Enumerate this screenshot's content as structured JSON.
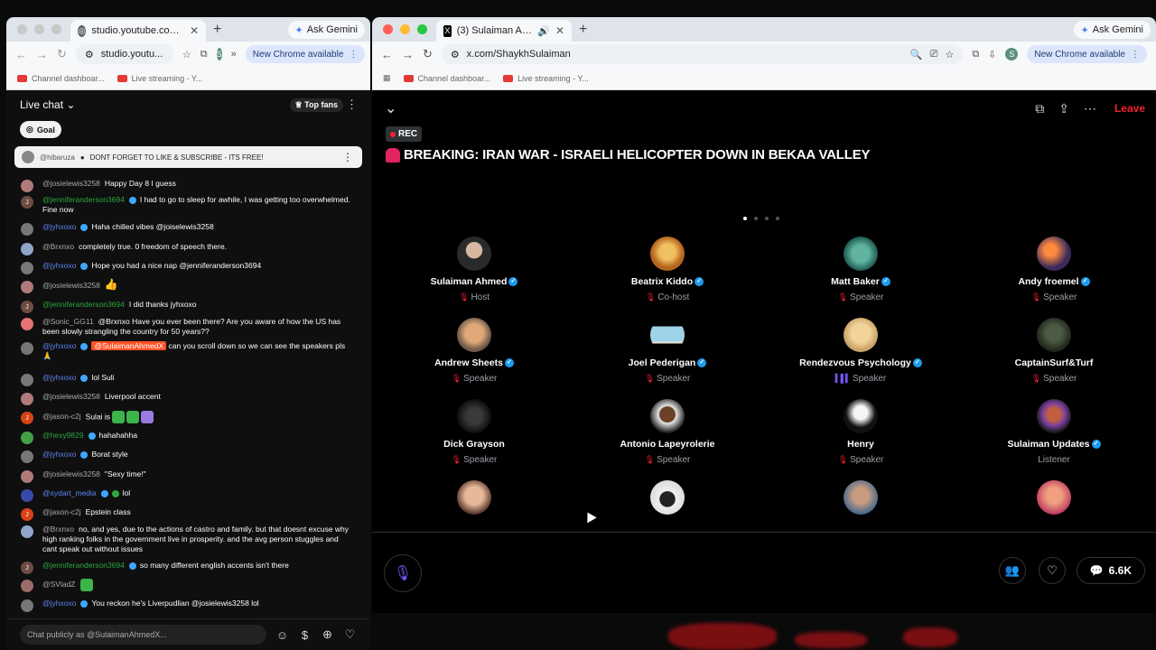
{
  "left_browser": {
    "tab_title": "studio.youtube.com/live_chat",
    "ask_gemini": "Ask Gemini",
    "address": "studio.youtu...",
    "new_chrome": "New Chrome available",
    "profile_initial": "S",
    "bookmarks": [
      "Channel dashboar...",
      "Live streaming - Y..."
    ]
  },
  "right_browser": {
    "tab_title": "(3) Sulaiman Ahmed (@S",
    "ask_gemini": "Ask Gemini",
    "address": "x.com/ShaykhSulaiman",
    "new_chrome": "New Chrome available",
    "profile_initial": "S",
    "bookmarks": [
      "Channel dashboar...",
      "Live streaming - Y..."
    ]
  },
  "chat": {
    "title": "Live chat",
    "top_fans": "Top fans",
    "goal": "Goal",
    "pinned": {
      "author": "@hibaruza",
      "text": "DONT FORGET TO LIKE & SUBSCRIBE - ITS FREE!"
    },
    "input_placeholder": "Chat publicly as @SulaimanAhmedX...",
    "messages": [
      {
        "author": "@josielewis3258",
        "text": "Happy Day 8 I guess"
      },
      {
        "author": "@jenniferanderson3694",
        "text": "I had to go to sleep for awhile, I was getting too overwhelmed. Fine now"
      },
      {
        "author": "@jyhxoxo",
        "text": "Haha chilled vibes @joiselewis3258"
      },
      {
        "author": "@Brxnxo",
        "text": "completely true. 0 freedom of speech there."
      },
      {
        "author": "@jyhxoxo",
        "text": "Hope you had a nice nap @jenniferanderson3694"
      },
      {
        "author": "@josielewis3258",
        "text": "👍"
      },
      {
        "author": "@jenniferanderson3694",
        "text": "I did thanks jyhxoxo"
      },
      {
        "author": "@Sonic_GG11",
        "text": "@Brxnxo Have you ever been there? Are you aware of how the US has been slowly strangling the country for 50 years??"
      },
      {
        "author": "@jyhxoxo",
        "mention": "@SulaimanAhmedX",
        "text": "can you scroll down so we can see the speakers pls 🙏"
      },
      {
        "author": "@jyhxoxo",
        "text": "lol Suli"
      },
      {
        "author": "@josielewis3258",
        "text": "Liverpool accent"
      },
      {
        "author": "@jason-c2j",
        "text": "Sulai is"
      },
      {
        "author": "@hexy9829",
        "text": "hahahahha"
      },
      {
        "author": "@jyhxoxo",
        "text": "Borat style"
      },
      {
        "author": "@josielewis3258",
        "text": "\"Sexy time!\""
      },
      {
        "author": "@sydart_media",
        "text": "lol"
      },
      {
        "author": "@jason-c2j",
        "text": "Epstein class"
      },
      {
        "author": "@Brxnxo",
        "text": "no, and yes, due to the actions of castro and family. but that doesnt excuse why high ranking folks in the government live in prosperity. and the avg person stuggles and cant speak out without issues"
      },
      {
        "author": "@jenniferanderson3694",
        "text": "so many different english accents isn't there"
      },
      {
        "author": "@SVladZ",
        "text": ""
      },
      {
        "author": "@jyhxoxo",
        "text": "You reckon he's Liverpudlian @josielewis3258 lol"
      }
    ]
  },
  "space": {
    "leave": "Leave",
    "rec": "REC",
    "title": "BREAKING: IRAN WAR - ISRAELI HELICOPTER DOWN IN BEKAA VALLEY",
    "count": "6.6K",
    "participants": [
      {
        "name": "Sulaiman Ahmed",
        "role": "Host",
        "verified": true,
        "muted": true
      },
      {
        "name": "Beatrix Kiddo",
        "role": "Co-host",
        "verified": true,
        "muted": true
      },
      {
        "name": "Matt Baker",
        "role": "Speaker",
        "verified": true,
        "muted": true
      },
      {
        "name": "Andy froemel",
        "role": "Speaker",
        "verified": true,
        "muted": true
      },
      {
        "name": "Andrew Sheets",
        "role": "Speaker",
        "verified": true,
        "muted": true
      },
      {
        "name": "Joel Pederigan",
        "role": "Speaker",
        "verified": true,
        "muted": true
      },
      {
        "name": "Rendezvous Psychology",
        "role": "Speaker",
        "verified": true,
        "speaking": true
      },
      {
        "name": "CaptainSurf&Turf",
        "role": "Speaker",
        "verified": false,
        "muted": true
      },
      {
        "name": "Dick Grayson",
        "role": "Speaker",
        "verified": false,
        "muted": true
      },
      {
        "name": "Antonio Lapeyrolerie",
        "role": "Speaker",
        "verified": false,
        "muted": true
      },
      {
        "name": "Henry",
        "role": "Speaker",
        "verified": false,
        "muted": true
      },
      {
        "name": "Sulaiman Updates",
        "role": "Listener",
        "verified": true,
        "muted": false
      }
    ]
  },
  "colors": {
    "accent_red": "#f4212e",
    "verified_blue": "#1d9bf0",
    "purple": "#7856ff",
    "yt_green": "#2ba640"
  }
}
